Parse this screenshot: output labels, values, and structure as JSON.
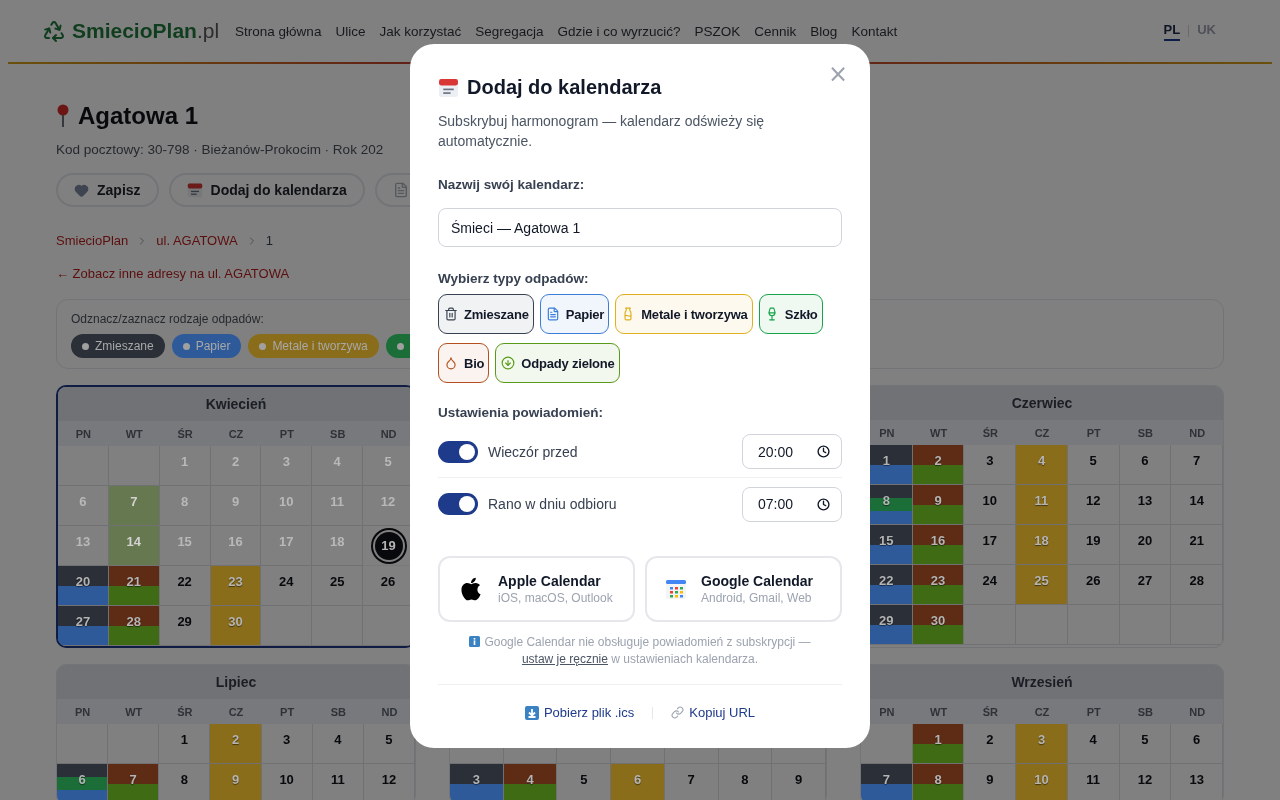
{
  "header": {
    "logo": "**SmiecioPlan**.pl",
    "nav": [
      "Strona główna",
      "Ulice",
      "Jak korzystać",
      "Segregacja",
      "Gdzie i co wyrzucić?",
      "PSZOK",
      "Cennik",
      "Blog",
      "Kontakt"
    ],
    "languages": [
      {
        "label": "PL",
        "selected": true
      },
      {
        "label": "UK",
        "selected": false
      }
    ]
  },
  "address": {
    "title": "Agatowa 1",
    "subtitle": "Kod pocztowy: 30-798 · Bieżanów-Prokocim · Rok 202",
    "actions": [
      {
        "kind": "save",
        "label": "Zapisz"
      },
      {
        "kind": "calendar",
        "label": "Dodaj do kalendarza"
      },
      {
        "kind": "document"
      }
    ]
  },
  "breadcrumb": [
    "SmiecioPlan",
    "ul. AGATOWA",
    "1"
  ],
  "back_link": "← Zobacz inne adresy na ul. AGATOWA",
  "filter": {
    "label": "Odznacz/zaznacz rodzaje odpadów:",
    "chips": [
      {
        "color": "#2a2f38",
        "label": "Zmieszane"
      },
      {
        "color": "#2f5a9a",
        "label": "Papier"
      },
      {
        "color": "#8a6d1a",
        "label": "Metale i tworzywa"
      },
      {
        "color": "#1b6e38"
      }
    ]
  },
  "calendar_rows": [
    [
      {
        "kind": "month",
        "name": "Kwiecień",
        "selected": true,
        "weekdays": [
          "PN",
          "WT",
          "ŚR",
          "CZ",
          "PT",
          "SB",
          "ND"
        ],
        "weeks": [
          [
            {
              "kind": "blank"
            },
            {
              "kind": "blank"
            },
            {
              "kind": "day",
              "day": "1",
              "past": true,
              "today": false
            },
            {
              "kind": "day",
              "day": "2",
              "past": true,
              "today": false
            },
            {
              "kind": "day",
              "day": "3",
              "past": true,
              "today": false
            },
            {
              "kind": "day",
              "day": "4",
              "past": true,
              "today": false
            },
            {
              "kind": "day",
              "day": "5",
              "past": true,
              "today": false
            }
          ],
          [
            {
              "kind": "day",
              "day": "6",
              "past": true,
              "today": false
            },
            {
              "kind": "day",
              "day": "7",
              "past": true,
              "today": false,
              "waste": [
                {
                  "color": "#65784f"
                }
              ]
            },
            {
              "kind": "day",
              "day": "8",
              "past": true,
              "today": false
            },
            {
              "kind": "day",
              "day": "9",
              "past": true,
              "today": false
            },
            {
              "kind": "day",
              "day": "10",
              "past": true,
              "today": false
            },
            {
              "kind": "day",
              "day": "11",
              "past": true,
              "today": false
            },
            {
              "kind": "day",
              "day": "12",
              "past": true,
              "today": false
            }
          ],
          [
            {
              "kind": "day",
              "day": "13",
              "past": true,
              "today": false
            },
            {
              "kind": "day",
              "day": "14",
              "past": true,
              "today": false,
              "waste": [
                {
                  "color": "#65784f"
                }
              ]
            },
            {
              "kind": "day",
              "day": "15",
              "past": true,
              "today": false
            },
            {
              "kind": "day",
              "day": "16",
              "past": true,
              "today": false
            },
            {
              "kind": "day",
              "day": "17",
              "past": true,
              "today": false
            },
            {
              "kind": "day",
              "day": "18",
              "past": true,
              "today": false
            },
            {
              "kind": "day",
              "day": "19",
              "past": false,
              "today": true
            }
          ],
          [
            {
              "kind": "day",
              "day": "20",
              "past": false,
              "today": false,
              "waste": [
                {
                  "color": "#2a2f38"
                },
                {
                  "color": "#2f5a9a"
                }
              ]
            },
            {
              "kind": "day",
              "day": "21",
              "past": false,
              "today": false,
              "waste": [
                {
                  "color": "#5e2c14"
                },
                {
                  "color": "#3f6b14"
                }
              ]
            },
            {
              "kind": "day",
              "day": "22",
              "past": false,
              "today": false
            },
            {
              "kind": "day",
              "day": "23",
              "past": false,
              "today": false,
              "waste": [
                {
                  "color": "#8a6d1a"
                }
              ]
            },
            {
              "kind": "day",
              "day": "24",
              "past": false,
              "today": false
            },
            {
              "kind": "day",
              "day": "25",
              "past": false,
              "today": false
            },
            {
              "kind": "day",
              "day": "26",
              "past": false,
              "today": false
            }
          ],
          [
            {
              "kind": "day",
              "day": "27",
              "past": false,
              "today": false,
              "waste": [
                {
                  "color": "#2a2f38"
                },
                {
                  "color": "#2f5a9a"
                }
              ]
            },
            {
              "kind": "day",
              "day": "28",
              "past": false,
              "today": false,
              "waste": [
                {
                  "color": "#5e2c14"
                },
                {
                  "color": "#3f6b14"
                }
              ]
            },
            {
              "kind": "day",
              "day": "29",
              "past": false,
              "today": false
            },
            {
              "kind": "day",
              "day": "30",
              "past": false,
              "today": false,
              "waste": [
                {
                  "color": "#8a6d1a"
                }
              ]
            },
            {
              "kind": "blank"
            },
            {
              "kind": "blank"
            },
            {
              "kind": "blank"
            }
          ]
        ]
      },
      {
        "kind": "hidden"
      },
      {
        "kind": "month",
        "name": "Czerwiec",
        "selected": false,
        "weekdays": [
          "PN",
          "WT",
          "ŚR",
          "CZ",
          "PT",
          "SB",
          "ND"
        ],
        "weeks": [
          [
            {
              "kind": "day",
              "day": "1",
              "past": false,
              "today": false,
              "waste": [
                {
                  "color": "#2a2f38"
                },
                {
                  "color": "#2f5a9a"
                }
              ]
            },
            {
              "kind": "day",
              "day": "2",
              "past": false,
              "today": false,
              "waste": [
                {
                  "color": "#5e2c14"
                },
                {
                  "color": "#3f6b14"
                }
              ]
            },
            {
              "kind": "day",
              "day": "3",
              "past": false,
              "today": false
            },
            {
              "kind": "day",
              "day": "4",
              "past": false,
              "today": false,
              "waste": [
                {
                  "color": "#8a6d1a"
                }
              ]
            },
            {
              "kind": "day",
              "day": "5",
              "past": false,
              "today": false
            },
            {
              "kind": "day",
              "day": "6",
              "past": false,
              "today": false
            },
            {
              "kind": "day",
              "day": "7",
              "past": false,
              "today": false
            }
          ],
          [
            {
              "kind": "day",
              "day": "8",
              "past": false,
              "today": false,
              "waste": [
                {
                  "color": "#2a2f38"
                },
                {
                  "color": "#1b6e38"
                },
                {
                  "color": "#2f5a9a"
                }
              ]
            },
            {
              "kind": "day",
              "day": "9",
              "past": false,
              "today": false,
              "waste": [
                {
                  "color": "#5e2c14"
                },
                {
                  "color": "#3f6b14"
                }
              ]
            },
            {
              "kind": "day",
              "day": "10",
              "past": false,
              "today": false
            },
            {
              "kind": "day",
              "day": "11",
              "past": false,
              "today": false,
              "waste": [
                {
                  "color": "#8a6d1a"
                }
              ]
            },
            {
              "kind": "day",
              "day": "12",
              "past": false,
              "today": false
            },
            {
              "kind": "day",
              "day": "13",
              "past": false,
              "today": false
            },
            {
              "kind": "day",
              "day": "14",
              "past": false,
              "today": false
            }
          ],
          [
            {
              "kind": "day",
              "day": "15",
              "past": false,
              "today": false,
              "waste": [
                {
                  "color": "#2a2f38"
                },
                {
                  "color": "#2f5a9a"
                }
              ]
            },
            {
              "kind": "day",
              "day": "16",
              "past": false,
              "today": false,
              "waste": [
                {
                  "color": "#5e2c14"
                },
                {
                  "color": "#3f6b14"
                }
              ]
            },
            {
              "kind": "day",
              "day": "17",
              "past": false,
              "today": false
            },
            {
              "kind": "day",
              "day": "18",
              "past": false,
              "today": false,
              "waste": [
                {
                  "color": "#8a6d1a"
                }
              ]
            },
            {
              "kind": "day",
              "day": "19",
              "past": false,
              "today": false
            },
            {
              "kind": "day",
              "day": "20",
              "past": false,
              "today": false
            },
            {
              "kind": "day",
              "day": "21",
              "past": false,
              "today": false
            }
          ],
          [
            {
              "kind": "day",
              "day": "22",
              "past": false,
              "today": false,
              "waste": [
                {
                  "color": "#2a2f38"
                },
                {
                  "color": "#2f5a9a"
                }
              ]
            },
            {
              "kind": "day",
              "day": "23",
              "past": false,
              "today": false,
              "waste": [
                {
                  "color": "#5e2c14"
                },
                {
                  "color": "#3f6b14"
                }
              ]
            },
            {
              "kind": "day",
              "day": "24",
              "past": false,
              "today": false
            },
            {
              "kind": "day",
              "day": "25",
              "past": false,
              "today": false,
              "waste": [
                {
                  "color": "#8a6d1a"
                }
              ]
            },
            {
              "kind": "day",
              "day": "26",
              "past": false,
              "today": false
            },
            {
              "kind": "day",
              "day": "27",
              "past": false,
              "today": false
            },
            {
              "kind": "day",
              "day": "28",
              "past": false,
              "today": false
            }
          ],
          [
            {
              "kind": "day",
              "day": "29",
              "past": false,
              "today": false,
              "waste": [
                {
                  "color": "#2a2f38"
                },
                {
                  "color": "#2f5a9a"
                }
              ]
            },
            {
              "kind": "day",
              "day": "30",
              "past": false,
              "today": false,
              "waste": [
                {
                  "color": "#5e2c14"
                },
                {
                  "color": "#3f6b14"
                }
              ]
            },
            {
              "kind": "blank"
            },
            {
              "kind": "blank"
            },
            {
              "kind": "blank"
            },
            {
              "kind": "blank"
            },
            {
              "kind": "blank"
            }
          ]
        ]
      }
    ],
    [
      {
        "kind": "month",
        "name": "Lipiec",
        "selected": false,
        "weekdays": [
          "PN",
          "WT",
          "ŚR",
          "CZ",
          "PT",
          "SB",
          "ND"
        ],
        "weeks": [
          [
            {
              "kind": "blank"
            },
            {
              "kind": "blank"
            },
            {
              "kind": "day",
              "day": "1",
              "past": false,
              "today": false
            },
            {
              "kind": "day",
              "day": "2",
              "past": false,
              "today": false,
              "waste": [
                {
                  "color": "#8a6d1a"
                }
              ]
            },
            {
              "kind": "day",
              "day": "3",
              "past": false,
              "today": false
            },
            {
              "kind": "day",
              "day": "4",
              "past": false,
              "today": false
            },
            {
              "kind": "day",
              "day": "5",
              "past": false,
              "today": false
            }
          ],
          [
            {
              "kind": "day",
              "day": "6",
              "past": false,
              "today": false,
              "waste": [
                {
                  "color": "#2a2f38"
                },
                {
                  "color": "#1b6e38"
                },
                {
                  "color": "#2f5a9a"
                }
              ]
            },
            {
              "kind": "day",
              "day": "7",
              "past": false,
              "today": false,
              "waste": [
                {
                  "color": "#5e2c14"
                },
                {
                  "color": "#3f6b14"
                }
              ]
            },
            {
              "kind": "day",
              "day": "8",
              "past": false,
              "today": false
            },
            {
              "kind": "day",
              "day": "9",
              "past": false,
              "today": false,
              "waste": [
                {
                  "color": "#8a6d1a"
                }
              ]
            },
            {
              "kind": "day",
              "day": "10",
              "past": false,
              "today": false
            },
            {
              "kind": "day",
              "day": "11",
              "past": false,
              "today": false
            },
            {
              "kind": "day",
              "day": "12",
              "past": false,
              "today": false
            }
          ]
        ]
      },
      {
        "kind": "month",
        "selected": false,
        "weeks": [
          [
            {
              "kind": "blank"
            },
            {
              "kind": "blank"
            },
            {
              "kind": "blank"
            },
            {
              "kind": "blank"
            },
            {
              "kind": "blank"
            },
            {
              "kind": "blank"
            },
            {
              "kind": "blank"
            }
          ],
          [
            {
              "kind": "day",
              "day": "3",
              "past": false,
              "today": false,
              "waste": [
                {
                  "color": "#2a2f38"
                },
                {
                  "color": "#2f5a9a"
                }
              ]
            },
            {
              "kind": "day",
              "day": "4",
              "past": false,
              "today": false,
              "waste": [
                {
                  "color": "#5e2c14"
                },
                {
                  "color": "#3f6b14"
                }
              ]
            },
            {
              "kind": "day",
              "day": "5",
              "past": false,
              "today": false
            },
            {
              "kind": "day",
              "day": "6",
              "past": false,
              "today": false,
              "waste": [
                {
                  "color": "#8a6d1a"
                }
              ]
            },
            {
              "kind": "day",
              "day": "7",
              "past": false,
              "today": false
            },
            {
              "kind": "day",
              "day": "8",
              "past": false,
              "today": false
            },
            {
              "kind": "day",
              "day": "9",
              "past": false,
              "today": false
            }
          ]
        ]
      },
      {
        "kind": "month",
        "name": "Wrzesień",
        "selected": false,
        "weekdays": [
          "PN",
          "WT",
          "ŚR",
          "CZ",
          "PT",
          "SB",
          "ND"
        ],
        "weeks": [
          [
            {
              "kind": "blank"
            },
            {
              "kind": "day",
              "day": "1",
              "past": false,
              "today": false,
              "waste": [
                {
                  "color": "#5e2c14"
                },
                {
                  "color": "#3f6b14"
                }
              ]
            },
            {
              "kind": "day",
              "day": "2",
              "past": false,
              "today": false
            },
            {
              "kind": "day",
              "day": "3",
              "past": false,
              "today": false,
              "waste": [
                {
                  "color": "#8a6d1a"
                }
              ]
            },
            {
              "kind": "day",
              "day": "4",
              "past": false,
              "today": false
            },
            {
              "kind": "day",
              "day": "5",
              "past": false,
              "today": false
            },
            {
              "kind": "day",
              "day": "6",
              "past": false,
              "today": false
            }
          ],
          [
            {
              "kind": "day",
              "day": "7",
              "past": false,
              "today": false,
              "waste": [
                {
                  "color": "#2a2f38"
                },
                {
                  "color": "#2f5a9a"
                }
              ]
            },
            {
              "kind": "day",
              "day": "8",
              "past": false,
              "today": false,
              "waste": [
                {
                  "color": "#5e2c14"
                },
                {
                  "color": "#3f6b14"
                }
              ]
            },
            {
              "kind": "day",
              "day": "9",
              "past": false,
              "today": false
            },
            {
              "kind": "day",
              "day": "10",
              "past": false,
              "today": false,
              "waste": [
                {
                  "color": "#8a6d1a"
                }
              ]
            },
            {
              "kind": "day",
              "day": "11",
              "past": false,
              "today": false
            },
            {
              "kind": "day",
              "day": "12",
              "past": false,
              "today": false
            },
            {
              "kind": "day",
              "day": "13",
              "past": false,
              "today": false
            }
          ]
        ]
      }
    ]
  ],
  "modal": {
    "title": "Dodaj do kalendarza",
    "close": "×",
    "intro": "Subskrybuj harmonogram — kalendarz odświeży się automatycznie.",
    "name_label": "Nazwij swój kalendarz:",
    "name_value": "Śmieci — Agatowa 1",
    "types_label": "Wybierz typy odpadów:",
    "types": [
      {
        "kind": "mixed",
        "color": "#374151",
        "label": "Zmieszane",
        "selected": true
      },
      {
        "kind": "paper",
        "color": "#3b7dd8",
        "label": "Papier",
        "selected": true
      },
      {
        "kind": "metal",
        "color": "#e0b020",
        "label": "Metale i tworzywa",
        "selected": true
      },
      {
        "kind": "glass",
        "color": "#16a34a",
        "label": "Szkło",
        "selected": true
      },
      {
        "kind": "bio",
        "color": "#b4501e",
        "label": "Bio",
        "selected": true
      },
      {
        "kind": "green",
        "color": "#5a9a1a",
        "label": "Odpady zielone",
        "selected": true
      }
    ],
    "notify_label": "Ustawienia powiadomień:",
    "notifications": [
      {
        "label": "Wieczór przed",
        "on": true,
        "time": "20:00"
      },
      {
        "label": "Rano w dniu odbioru",
        "on": true,
        "time": "07:00"
      }
    ],
    "providers": [
      {
        "kind": "apple",
        "name": "Apple Calendar",
        "platforms": "iOS, macOS, Outlook"
      },
      {
        "kind": "google",
        "name": "Google Calendar",
        "platforms": "Android, Gmail, Web"
      }
    ],
    "note": {
      "before": "Google Calendar nie obsługuje powiadomień z subskrypcji —",
      "link": "ustaw je ręcznie",
      "after": "w ustawieniach kalendarza."
    },
    "footer": [
      {
        "kind": "download",
        "label": "Pobierz plik .ics"
      },
      {
        "kind": "link",
        "label": "Kopiuj URL"
      }
    ]
  }
}
